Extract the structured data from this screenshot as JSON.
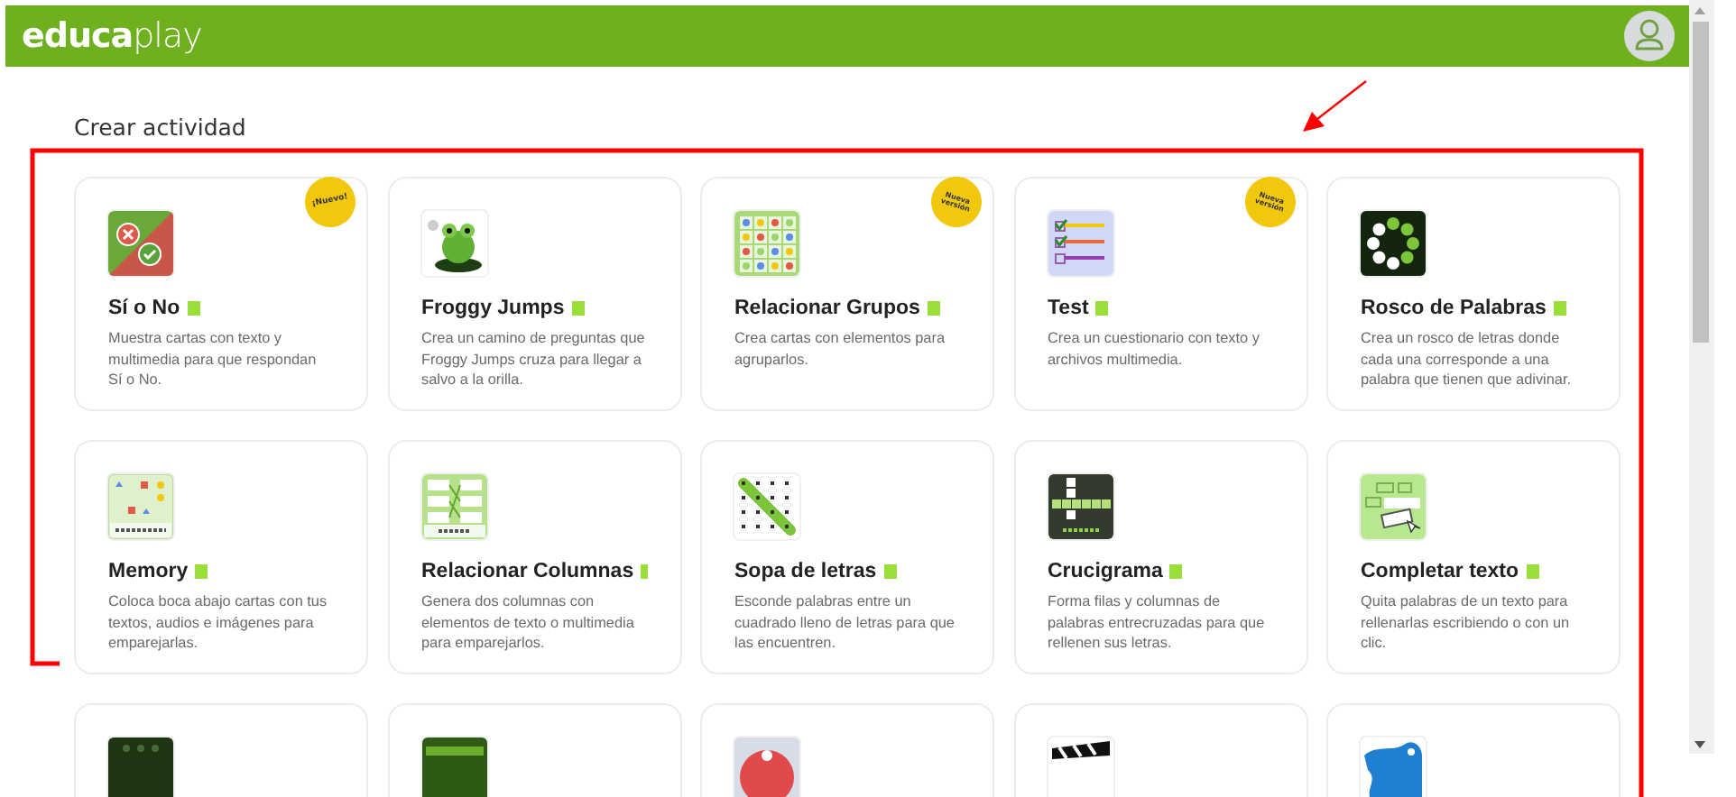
{
  "header": {
    "logo": "**educa**play"
  },
  "page_title": "Crear actividad",
  "cards": [
    {
      "kind": "yesno",
      "title": "Sí o No",
      "description": "Muestra cartas con texto y multimedia para que respondan Sí o No.",
      "badge": {
        "kind": "new",
        "text": "¡Nuevo!"
      }
    },
    {
      "kind": "frog",
      "title": "Froggy Jumps",
      "description": "Crea un camino de preguntas que Froggy Jumps cruza para llegar a salvo a la orilla."
    },
    {
      "kind": "groups",
      "title": "Relacionar Grupos",
      "description": "Crea cartas con elementos para agruparlos.",
      "badge": {
        "kind": "version",
        "text": "Nueva versión"
      }
    },
    {
      "kind": "test",
      "title": "Test",
      "description": "Crea un cuestionario con texto y archivos multimedia.",
      "badge": {
        "kind": "version",
        "text": "Nueva versión"
      }
    },
    {
      "kind": "rosco",
      "title": "Rosco de Palabras",
      "description": "Crea un rosco de letras donde cada una corresponde a una palabra que tienen que adivinar."
    },
    {
      "kind": "memory",
      "title": "Memory",
      "description": "Coloca boca abajo cartas con tus textos, audios e imágenes para emparejarlas."
    },
    {
      "kind": "pairs",
      "title": "Relacionar Columnas",
      "description": "Genera dos columnas con elementos de texto o multimedia para emparejarlos."
    },
    {
      "kind": "wordsearch",
      "title": "Sopa de letras",
      "description": "Esconde palabras entre un cuadrado lleno de letras para que las encuentren."
    },
    {
      "kind": "crossword",
      "title": "Crucigrama",
      "description": "Forma filas y columnas de palabras entrecruzadas para que rellenen sus letras."
    },
    {
      "kind": "fillin",
      "title": "Completar texto",
      "description": "Quita palabras de un texto para rellenarlas escribiendo o con un clic."
    },
    {
      "kind": "dots"
    },
    {
      "kind": "greenbar"
    },
    {
      "kind": "redcircle"
    },
    {
      "kind": "clapper"
    },
    {
      "kind": "map"
    }
  ]
}
